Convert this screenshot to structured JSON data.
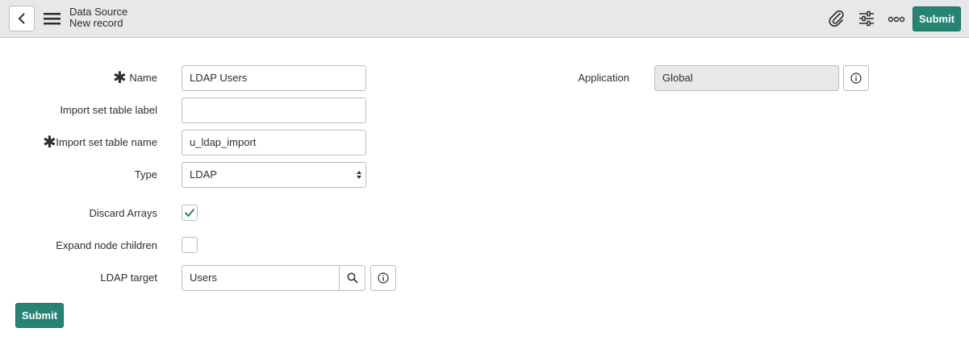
{
  "header": {
    "title": "Data Source",
    "subtitle": "New record",
    "submit_label": "Submit",
    "icons": [
      "back-icon",
      "hamburger-menu-icon",
      "paperclip-icon",
      "sliders-icon",
      "more-icon"
    ]
  },
  "form": {
    "name": {
      "label": "Name",
      "value": "LDAP Users",
      "required": true
    },
    "import_set_table_label": {
      "label": "Import set table label",
      "value": ""
    },
    "import_set_table_name": {
      "label": "Import set table name",
      "value": "u_ldap_import",
      "required": true
    },
    "type": {
      "label": "Type",
      "value": "LDAP"
    },
    "discard_arrays": {
      "label": "Discard Arrays",
      "checked": true
    },
    "expand_node_children": {
      "label": "Expand node children",
      "checked": false
    },
    "ldap_target": {
      "label": "LDAP target",
      "value": "Users"
    },
    "application": {
      "label": "Application",
      "value": "Global"
    }
  },
  "footer": {
    "submit_label": "Submit"
  },
  "colors": {
    "accent": "#278474",
    "header_bg": "#e6e8ea",
    "readonly_bg": "#e6e8ea"
  }
}
